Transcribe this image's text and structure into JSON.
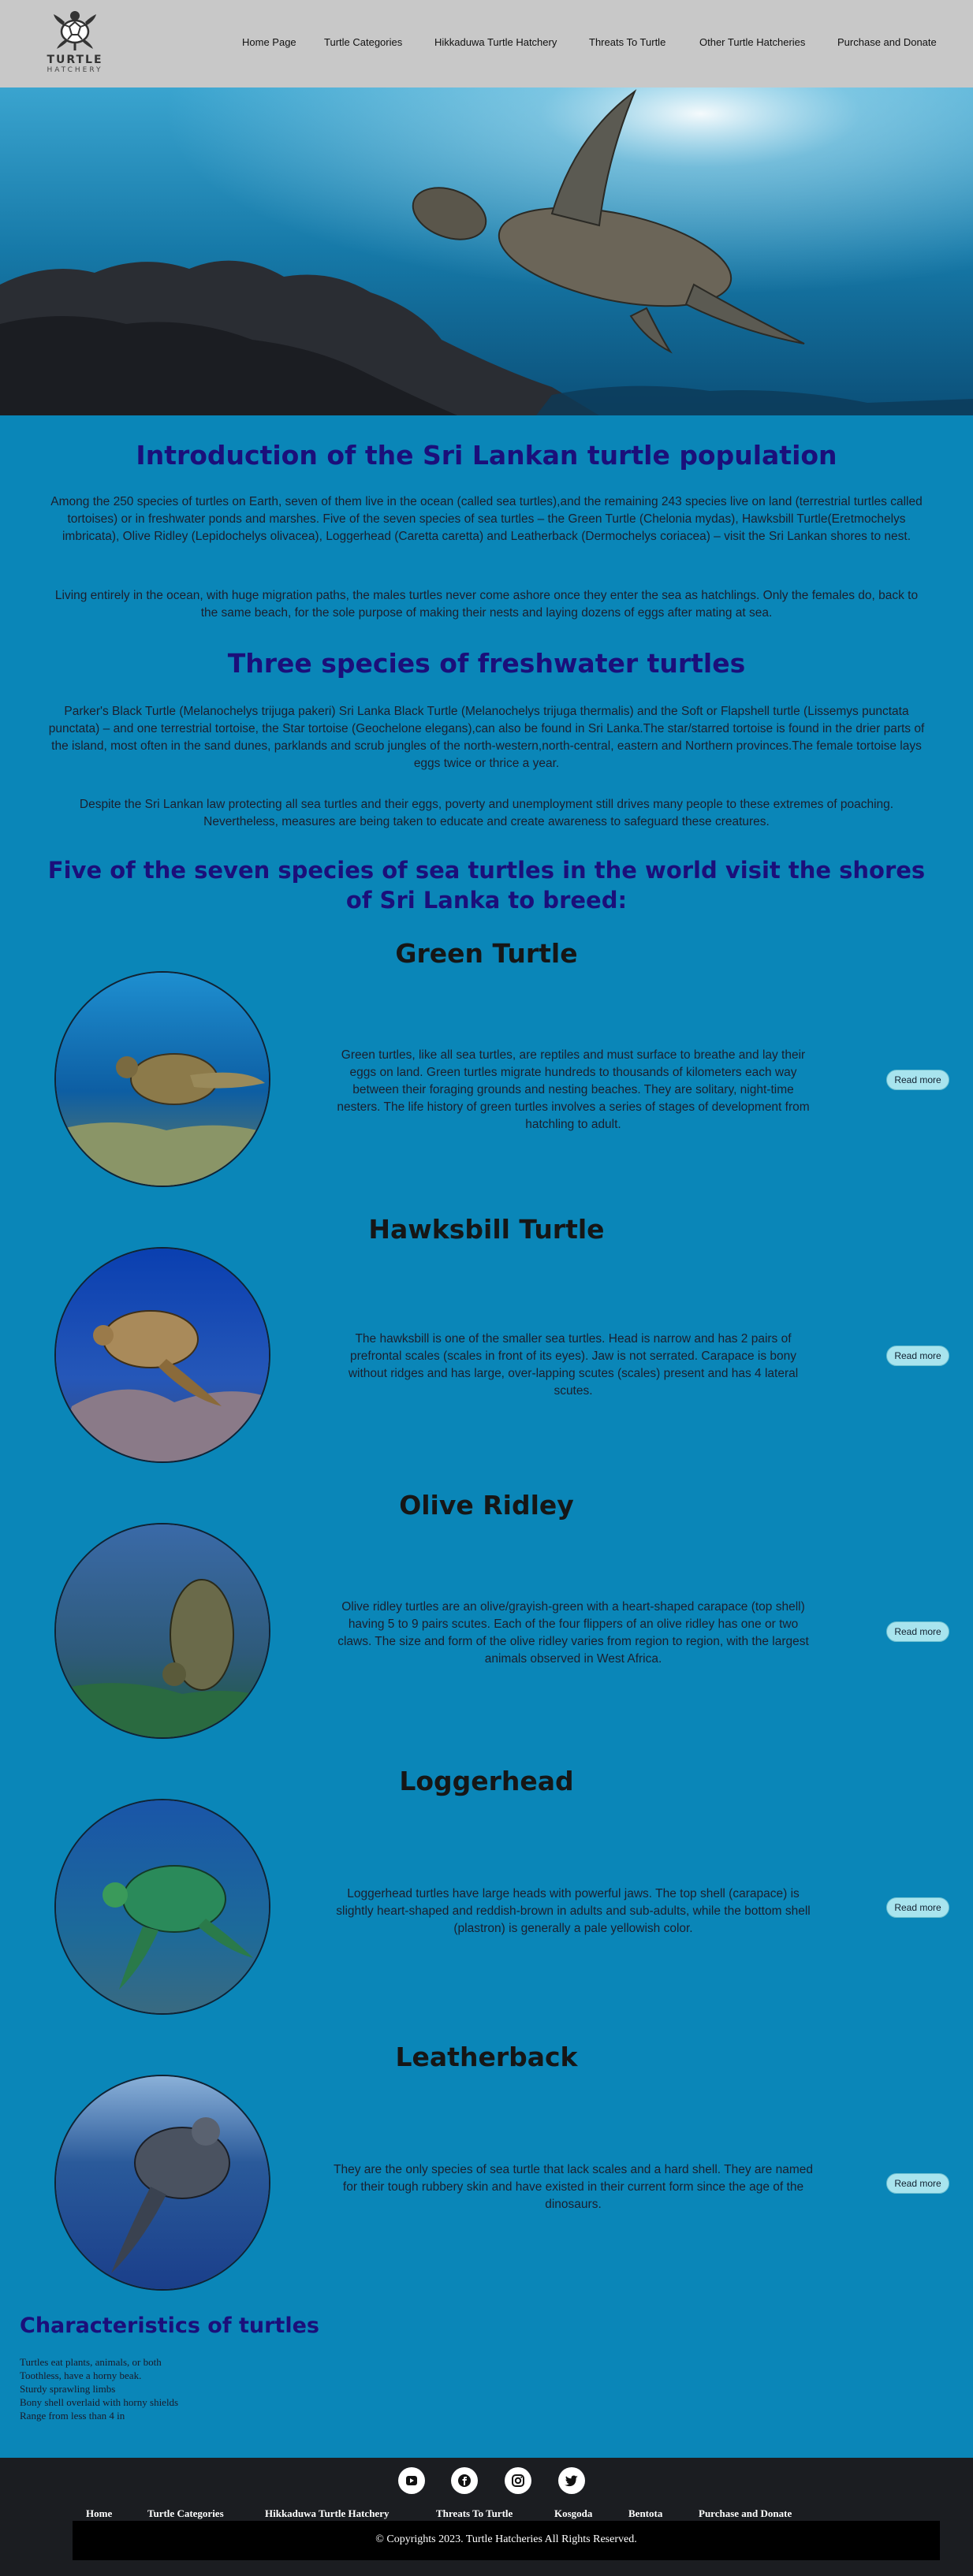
{
  "header": {
    "logo_title": "TURTLE",
    "logo_subtitle": "HATCHERY",
    "nav": [
      "Home Page",
      "Turtle Categories",
      "Hikkaduwa Turtle Hatchery",
      "Threats To Turtle",
      "Other Turtle Hatcheries",
      "Purchase and Donate"
    ]
  },
  "intro": {
    "title": "Introduction of the Sri Lankan turtle population",
    "p1": "Among the 250 species of turtles on Earth, seven of them live in the ocean (called sea turtles),and the remaining 243 species live on land (terrestrial turtles called tortoises) or in freshwater ponds and marshes. Five of the seven species of sea turtles – the Green Turtle (Chelonia mydas), Hawksbill Turtle(Eretmochelys imbricata), Olive Ridley (Lepidochelys olivacea), Loggerhead (Caretta caretta) and Leatherback (Dermochelys coriacea) – visit the Sri Lankan shores to nest.",
    "p2": "Living entirely in the ocean, with huge migration paths, the males turtles never come ashore once they enter the sea as hatchlings. Only the females do, back to the same beach, for the sole purpose of making their nests and laying dozens of eggs after mating at sea."
  },
  "freshwater": {
    "title": "Three species of freshwater turtles",
    "p1": "Parker's Black Turtle (Melanochelys trijuga pakeri) Sri Lanka Black Turtle (Melanochelys trijuga thermalis) and the Soft or Flapshell turtle (Lissemys punctata punctata) – and one terrestrial tortoise, the Star tortoise (Geochelone elegans),can also be found in Sri Lanka.The star/starred tortoise is found in the drier parts of the island, most often in the sand dunes, parklands and scrub jungles of the north-western,north-central, eastern and Northern provinces.The female tortoise lays eggs twice or thrice a year.",
    "p2": "Despite the Sri Lankan law protecting all sea turtles and their eggs, poverty and unemployment still drives many people to these extremes of poaching. Nevertheless, measures are being taken to educate and create awareness to safeguard these creatures."
  },
  "sea": {
    "title": "Five of the seven species of sea turtles in the world visit the shores of Sri Lanka to breed:"
  },
  "read_more_label": "Read more",
  "species": [
    {
      "name": "Green Turtle",
      "desc": "Green turtles, like all sea turtles, are reptiles and must surface to breathe and lay their eggs on land. Green turtles migrate hundreds to thousands of kilometers each way between their foraging grounds and nesting beaches. They are solitary, night-time nesters. The life history of green turtles involves a series of stages of development from hatchling to adult."
    },
    {
      "name": "Hawksbill Turtle",
      "desc": "The hawksbill is one of the smaller sea turtles. Head is narrow and has 2 pairs of prefrontal scales (scales in front of its eyes). Jaw is not serrated. Carapace is bony without ridges and has large, over-lapping scutes (scales) present and has 4 lateral scutes."
    },
    {
      "name": "Olive Ridley",
      "desc": "Olive ridley turtles are an olive/grayish-green with a heart-shaped carapace (top shell) having 5 to 9 pairs scutes. Each of the four flippers of an olive ridley has one or two claws. The size and form of the olive ridley varies from region to region, with the largest animals observed in West Africa."
    },
    {
      "name": "Loggerhead",
      "desc": "Loggerhead turtles have large heads with powerful jaws. The top shell (carapace) is slightly heart-shaped and reddish-brown in adults and sub-adults, while the bottom shell (plastron) is generally a pale yellowish color."
    },
    {
      "name": "Leatherback",
      "desc": "They are the only species of sea turtle that lack scales and a hard shell. They are named for their tough rubbery skin and have existed in their current form since the age of the dinosaurs."
    }
  ],
  "characteristics": {
    "title": "Characteristics of turtles",
    "items": [
      "Turtles eat plants, animals, or both",
      "Toothless, have a horny beak.",
      "Sturdy sprawling limbs",
      "Bony shell overlaid with horny shields",
      "Range from less than 4 in"
    ]
  },
  "footer": {
    "social_icons": [
      "youtube-icon",
      "facebook-icon",
      "instagram-icon",
      "twitter-icon"
    ],
    "nav": [
      "Home",
      "Turtle Categories",
      "Hikkaduwa Turtle Hatchery",
      "Threats To Turtle",
      "Kosgoda",
      "Bentota",
      "Purchase and Donate"
    ],
    "copyright": "© Copyrights 2023. Turtle Hatcheries All Rights Reserved."
  },
  "colors": {
    "page_bg": "#0a86b8",
    "header_bg": "#c8c8c8",
    "heading": "#1b0f7a",
    "footer_bg": "#1b1d21",
    "button_bg": "#a8e4ee"
  }
}
